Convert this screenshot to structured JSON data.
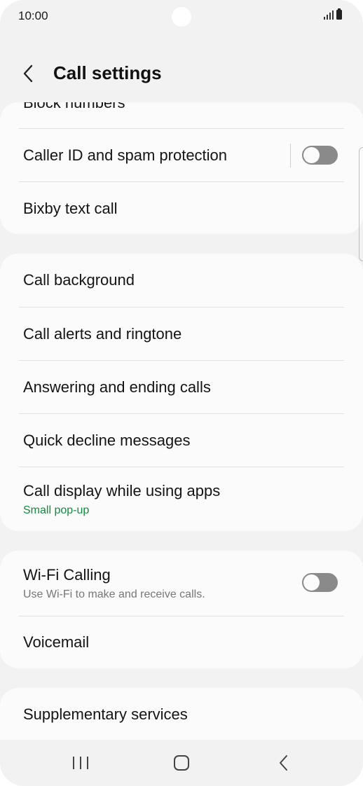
{
  "status_bar": {
    "time": "10:00"
  },
  "header": {
    "title": "Call settings"
  },
  "groups": [
    {
      "items": [
        {
          "title": "Block numbers"
        },
        {
          "title": "Caller ID and spam protection",
          "toggle": false
        },
        {
          "title": "Bixby text call"
        }
      ]
    },
    {
      "items": [
        {
          "title": "Call background"
        },
        {
          "title": "Call alerts and ringtone"
        },
        {
          "title": "Answering and ending calls"
        },
        {
          "title": "Quick decline messages"
        },
        {
          "title": "Call display while using apps",
          "subtitle": "Small pop-up"
        }
      ]
    },
    {
      "items": [
        {
          "title": "Wi-Fi Calling",
          "subtitle": "Use Wi-Fi to make and receive calls.",
          "toggle": false
        },
        {
          "title": "Voicemail"
        }
      ]
    },
    {
      "items": [
        {
          "title": "Supplementary services"
        }
      ]
    }
  ],
  "colors": {
    "accent_green": "#148a3e",
    "toggle_off": "#8a8a8a",
    "card": "#fbfbfb",
    "background": "#f2f2f2"
  },
  "icons": {
    "back": "chevron-left-icon",
    "recents": "recents-icon",
    "home": "home-icon",
    "nav_back": "back-icon"
  }
}
